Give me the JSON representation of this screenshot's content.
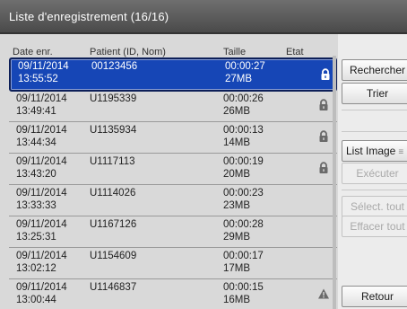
{
  "window": {
    "title": "Liste d'enregistrement  (16/16)"
  },
  "columns": {
    "date": "Date enr.",
    "patient": "Patient (ID, Nom)",
    "size": "Taille",
    "state": "Etat"
  },
  "rows": [
    {
      "date": "09/11/2014",
      "time": "13:55:52",
      "patient": "00123456",
      "duration": "00:00:27",
      "size": "27MB",
      "state_icon": "lock-icon",
      "selected": true
    },
    {
      "date": "09/11/2014",
      "time": "13:49:41",
      "patient": "U1195339",
      "duration": "00:00:26",
      "size": "26MB",
      "state_icon": "lock-icon",
      "selected": false
    },
    {
      "date": "09/11/2014",
      "time": "13:44:34",
      "patient": "U1135934",
      "duration": "00:00:13",
      "size": "14MB",
      "state_icon": "lock-icon",
      "selected": false
    },
    {
      "date": "09/11/2014",
      "time": "13:43:20",
      "patient": "U1117113",
      "duration": "00:00:19",
      "size": "20MB",
      "state_icon": "lock-icon",
      "selected": false
    },
    {
      "date": "09/11/2014",
      "time": "13:33:33",
      "patient": "U1114026",
      "duration": "00:00:23",
      "size": "23MB",
      "state_icon": "",
      "selected": false
    },
    {
      "date": "09/11/2014",
      "time": "13:25:31",
      "patient": "U1167126",
      "duration": "00:00:28",
      "size": "29MB",
      "state_icon": "",
      "selected": false
    },
    {
      "date": "09/11/2014",
      "time": "13:02:12",
      "patient": "U1154609",
      "duration": "00:00:17",
      "size": "17MB",
      "state_icon": "",
      "selected": false
    },
    {
      "date": "09/11/2014",
      "time": "13:00:44",
      "patient": "U1146837",
      "duration": "00:00:15",
      "size": "16MB",
      "state_icon": "warning-icon",
      "selected": false
    }
  ],
  "sidebar": {
    "search": "Rechercher",
    "sort": "Trier",
    "list_mode": "List Image",
    "execute": "Exécuter",
    "select_all": "Sélect. tout",
    "clear_all": "Effacer tout",
    "back": "Retour"
  },
  "colors": {
    "selected_row": "#1646b6",
    "title_bar": "#555555",
    "list_background": "#d9d9d9"
  }
}
